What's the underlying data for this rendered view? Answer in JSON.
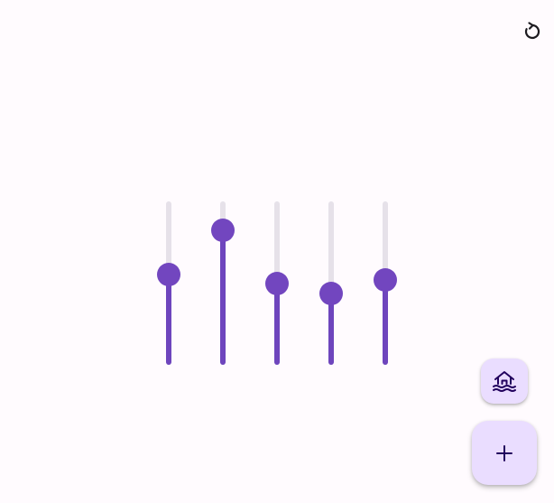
{
  "toolbar": {
    "reset_icon": "refresh-icon"
  },
  "colors": {
    "background": "#fffbfe",
    "track": "#e6e1e9",
    "active": "#6e45bd",
    "fab_container": "#eaddff",
    "icon": "#21005d"
  },
  "equalizer": {
    "sliders": [
      {
        "id": "band-1",
        "level": 0.56
      },
      {
        "id": "band-2",
        "level": 0.87
      },
      {
        "id": "band-3",
        "level": 0.5
      },
      {
        "id": "band-4",
        "level": 0.43
      },
      {
        "id": "band-5",
        "level": 0.52
      }
    ]
  },
  "fabs": {
    "small_icon": "beach-house-icon",
    "large_icon": "add-icon"
  }
}
